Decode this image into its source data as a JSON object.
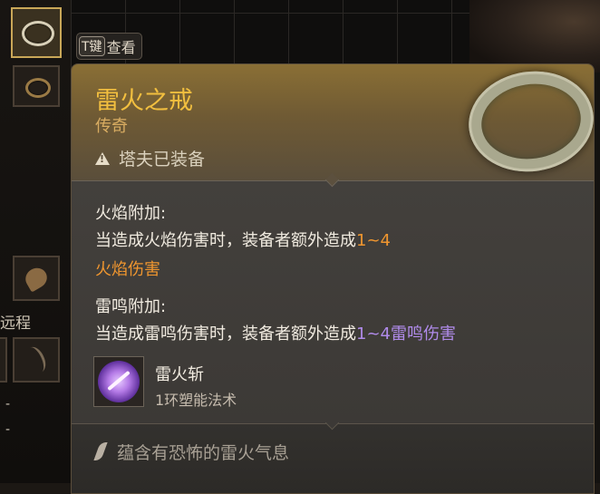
{
  "inventory": {
    "inspect_key": "T键",
    "inspect_label": "查看",
    "side_label": "远程",
    "dash_1": "-",
    "dash_2": "-"
  },
  "tooltip": {
    "item_name": "雷火之戒",
    "rarity": "传奇",
    "equipped_status": "塔夫已装备",
    "properties": [
      {
        "title": "火焰附加:",
        "text": "当造成火焰伤害时，装备者额外造成",
        "value": "1~4",
        "damage_type": "火焰伤害"
      },
      {
        "title": "雷鸣附加:",
        "text": "当造成雷鸣伤害时，装备者额外造成",
        "value": "1~4雷鸣伤害"
      }
    ],
    "spell": {
      "name": "雷火斩",
      "level": "1环塑能法术"
    },
    "flavor_text": "蕴含有恐怖的雷火气息"
  },
  "colors": {
    "name": "#f2bf3f",
    "rarity": "#d9ad62",
    "fire": "#f0962f",
    "thunder": "#b08bea",
    "flavor": "#a8a094"
  },
  "icons": {
    "slot_1": "ring-icon",
    "slot_2": "ring-icon",
    "equipped": "warning-icon",
    "spell": "thunder-fire-slash-icon",
    "flavor": "quill-icon"
  }
}
